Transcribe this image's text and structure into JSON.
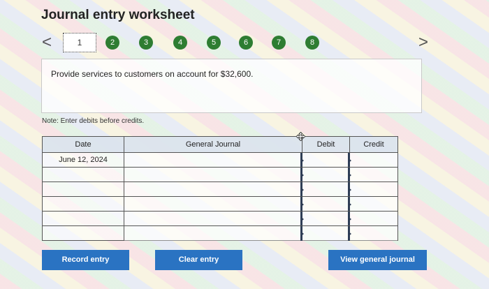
{
  "title": "Journal entry worksheet",
  "steps": [
    "1",
    "2",
    "3",
    "4",
    "5",
    "6",
    "7",
    "8"
  ],
  "nav": {
    "prev_icon": "chevron-left-icon",
    "prev": "<",
    "next_icon": "chevron-right-icon",
    "next": ">"
  },
  "prompt": "Provide services to customers on account for $32,600.",
  "note": "Note: Enter debits before credits.",
  "journal": {
    "headers": {
      "date": "Date",
      "account": "General Journal",
      "debit": "Debit",
      "credit": "Credit"
    },
    "rows": [
      {
        "date": "June 12, 2024",
        "account": "",
        "debit": "",
        "credit": ""
      },
      {
        "date": "",
        "account": "",
        "debit": "",
        "credit": ""
      },
      {
        "date": "",
        "account": "",
        "debit": "",
        "credit": ""
      },
      {
        "date": "",
        "account": "",
        "debit": "",
        "credit": ""
      },
      {
        "date": "",
        "account": "",
        "debit": "",
        "credit": ""
      },
      {
        "date": "",
        "account": "",
        "debit": "",
        "credit": ""
      }
    ]
  },
  "buttons": {
    "record": "Record entry",
    "clear": "Clear entry",
    "view": "View general journal"
  },
  "colors": {
    "step_green": "#2e7d32",
    "button_blue": "#2a73c2",
    "field_marker": "#2f3e56"
  }
}
